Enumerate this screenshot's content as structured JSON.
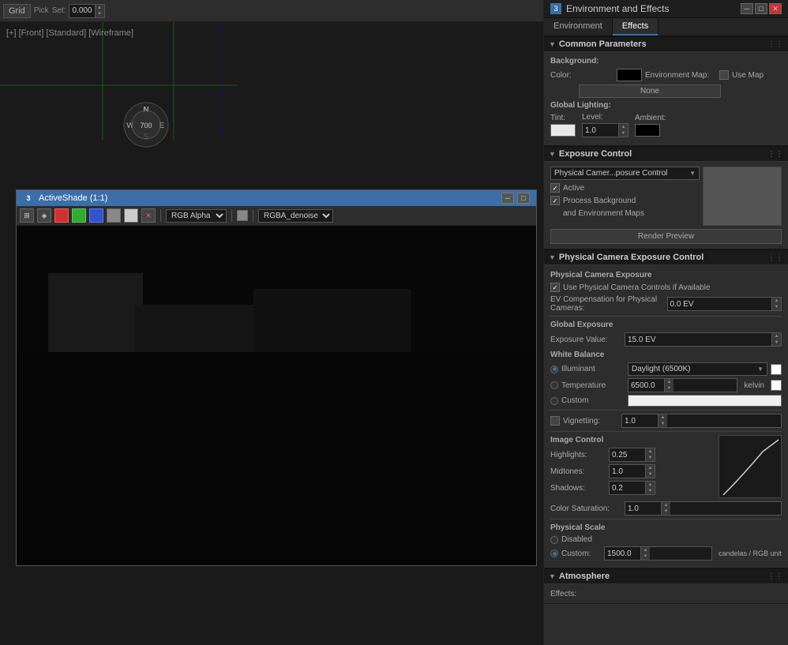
{
  "mainViewport": {
    "label": "[+] [Front] [Standard] [Wireframe]",
    "grid": "Grid"
  },
  "toolbar": {
    "pick_label": "Pick",
    "set_label": "Set:",
    "value": "0.000"
  },
  "activeShade": {
    "title": "ActiveShade (1:1)",
    "number": "3",
    "channel1": "RGB Alpha",
    "channel2": "RGBA_denoise"
  },
  "panel": {
    "title": "Environment and Effects",
    "number": "3",
    "tabs": [
      "Environment",
      "Effects"
    ],
    "active_tab": "Effects"
  },
  "commonParams": {
    "title": "Common Parameters",
    "background_label": "Background:",
    "color_label": "Color:",
    "env_map_label": "Environment Map:",
    "use_map_label": "Use Map",
    "none_label": "None",
    "global_lighting_label": "Global Lighting:",
    "tint_label": "Tint:",
    "level_label": "Level:",
    "level_value": "1.0",
    "ambient_label": "Ambient:"
  },
  "exposureControl": {
    "title": "Exposure Control",
    "dropdown_value": "Physical Camer...posure Control",
    "active_label": "Active",
    "process_bg_label": "Process Background",
    "and_env_maps_label": "and Environment Maps",
    "render_preview_label": "Render Preview"
  },
  "physicalCameraExposure": {
    "title": "Physical Camera Exposure Control",
    "exposure_label": "Physical Camera Exposure",
    "use_controls_label": "Use Physical Camera Controls if Available",
    "ev_label": "EV Compensation for Physical Cameras:",
    "ev_value": "0.0 EV",
    "global_exposure_label": "Global Exposure",
    "exposure_value_label": "Exposure Value:",
    "exposure_value": "15.0 EV",
    "white_balance_label": "White Balance",
    "illuminant_label": "Illuminant",
    "illuminant_value": "Daylight (6500K)",
    "temperature_label": "Temperature",
    "temperature_value": "6500.0",
    "kelvin_label": "kelvin",
    "custom_label": "Custom",
    "vignetting_label": "Vignetting:",
    "vignetting_value": "1.0",
    "image_control_label": "Image Control",
    "highlights_label": "Highlights:",
    "highlights_value": "0.25",
    "midtones_label": "Midtones:",
    "midtones_value": "1.0",
    "shadows_label": "Shadows:",
    "shadows_value": "0.2",
    "color_saturation_label": "Color Saturation:",
    "color_saturation_value": "1.0",
    "physical_scale_label": "Physical Scale",
    "disabled_label": "Disabled",
    "custom_scale_label": "Custom:",
    "custom_scale_value": "1500.0",
    "candelas_label": "candelas / RGB unit"
  },
  "atmosphere": {
    "title": "Atmosphere",
    "effects_label": "Effects:"
  }
}
